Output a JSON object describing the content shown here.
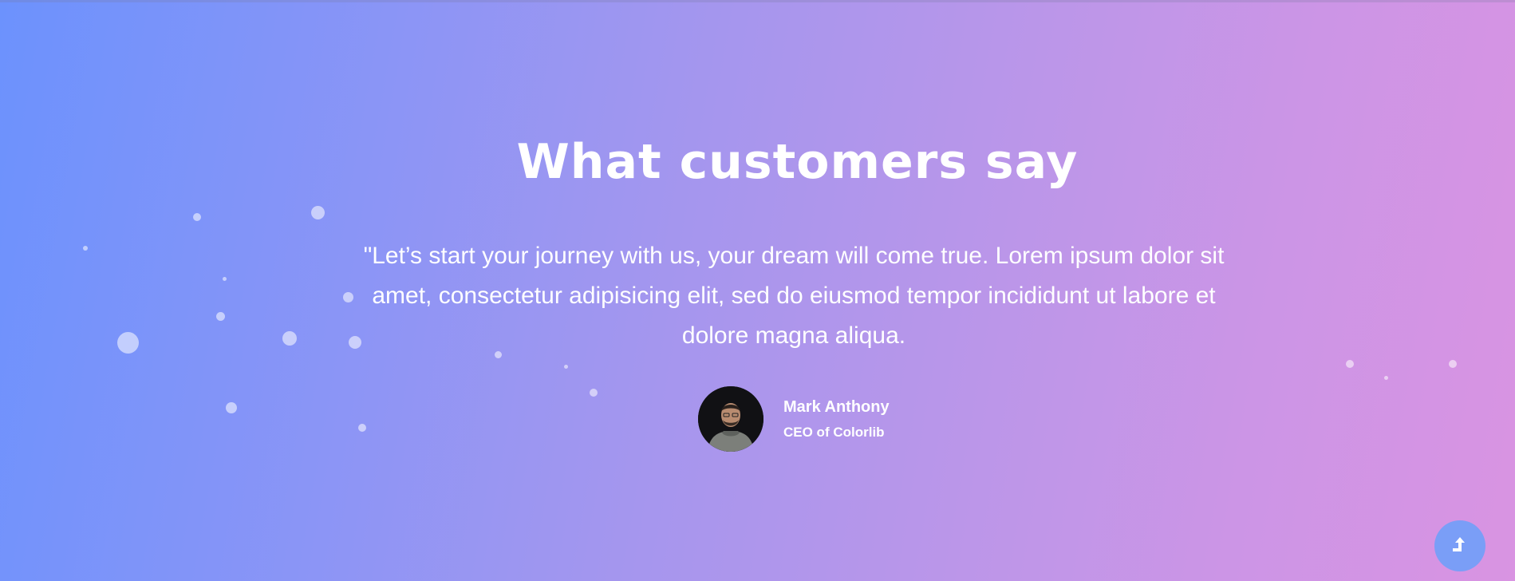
{
  "section": {
    "title": "What customers say",
    "quote": "\"Let’s start your journey with us, your dream will come true. Lorem ipsum dolor sit amet, consectetur adipisicing elit, sed do eiusmod tempor incididunt ut labore et dolore magna aliqua.",
    "author": {
      "name": "Mark Anthony",
      "role": "CEO of Colorlib"
    }
  },
  "scroll_top": {
    "icon": "arrow-up-icon"
  },
  "colors": {
    "gradient_start": "#6c92fd",
    "gradient_end": "#d994e2",
    "scroll_button": "#7a9ef7"
  }
}
